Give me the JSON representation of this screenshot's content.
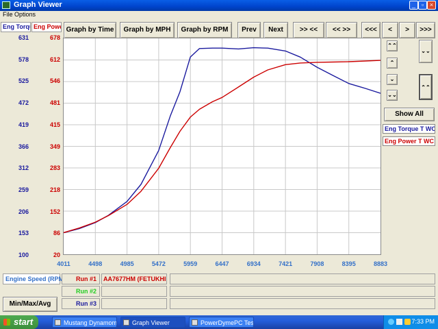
{
  "window": {
    "title": "Graph Viewer",
    "menu": [
      "File",
      "Options"
    ]
  },
  "toolbar": {
    "y_headers": {
      "torque": "Eng Torque T WC",
      "power": "Eng Power T WC"
    },
    "buttons": [
      "Graph by Time",
      "Graph by MPH",
      "Graph by RPM",
      "Prev",
      "Next",
      ">> <<",
      "<< >>",
      "<<<",
      "<",
      ">",
      ">>>"
    ]
  },
  "chart_data": {
    "type": "line",
    "xlabel": "Engine Speed (RPM)",
    "x_ticks": [
      "4011",
      "4498",
      "4985",
      "5472",
      "5959",
      "6447",
      "6934",
      "7421",
      "7908",
      "8395",
      "8883"
    ],
    "xlim": [
      4011,
      8883
    ],
    "y_axes": [
      {
        "name": "Eng Torque T WC",
        "color": "#1a1a9e",
        "ticks": [
          "100",
          "153",
          "206",
          "259",
          "312",
          "366",
          "419",
          "472",
          "525",
          "578",
          "631"
        ],
        "ylim": [
          100,
          631
        ]
      },
      {
        "name": "Eng Power T WC",
        "color": "#cc0000",
        "ticks": [
          "20",
          "86",
          "152",
          "218",
          "283",
          "349",
          "415",
          "481",
          "546",
          "612",
          "678"
        ],
        "ylim": [
          20,
          678
        ]
      }
    ],
    "grid": true,
    "series": [
      {
        "name": "Eng Torque T WC",
        "axis": 0,
        "color": "#1a1a9e",
        "x": [
          4011,
          4250,
          4498,
          4700,
          4985,
          5200,
          5472,
          5650,
          5800,
          5959,
          6100,
          6300,
          6447,
          6700,
          6934,
          7150,
          7421,
          7650,
          7908,
          8150,
          8395,
          8650,
          8883
        ],
        "y": [
          153,
          163,
          178,
          196,
          230,
          272,
          355,
          440,
          500,
          585,
          606,
          607,
          607,
          605,
          608,
          607,
          600,
          585,
          560,
          540,
          520,
          508,
          496
        ]
      },
      {
        "name": "Eng Power T WC",
        "axis": 1,
        "color": "#cc0000",
        "x": [
          4011,
          4250,
          4498,
          4700,
          4985,
          5200,
          5472,
          5650,
          5800,
          5959,
          6100,
          6300,
          6447,
          6700,
          6934,
          7150,
          7421,
          7650,
          7908,
          8150,
          8395,
          8650,
          8883
        ],
        "y": [
          86,
          100,
          118,
          138,
          172,
          212,
          282,
          345,
          395,
          438,
          462,
          485,
          498,
          530,
          560,
          582,
          598,
          603,
          605,
          606,
          607,
          609,
          611
        ]
      }
    ]
  },
  "side": {
    "show_all": "Show All",
    "legend": [
      "Eng Torque T WC",
      "Eng Power T WC"
    ]
  },
  "bottom": {
    "x_channel": "Engine Speed (RPM)",
    "runs": [
      {
        "label": "Run #1",
        "color": "#cc0000",
        "file": "AA7677HM (FETUKHIH"
      },
      {
        "label": "Run #2",
        "color": "#22cc22",
        "file": ""
      },
      {
        "label": "Run #3",
        "color": "#1a1a9e",
        "file": ""
      }
    ],
    "minmax": "Min/Max/Avg"
  },
  "taskbar": {
    "start": "start",
    "tasks": [
      "Mustang Dynamomet...",
      "Graph Viewer",
      "PowerDymePC Test Pi..."
    ],
    "clock": "7:33 PM"
  }
}
